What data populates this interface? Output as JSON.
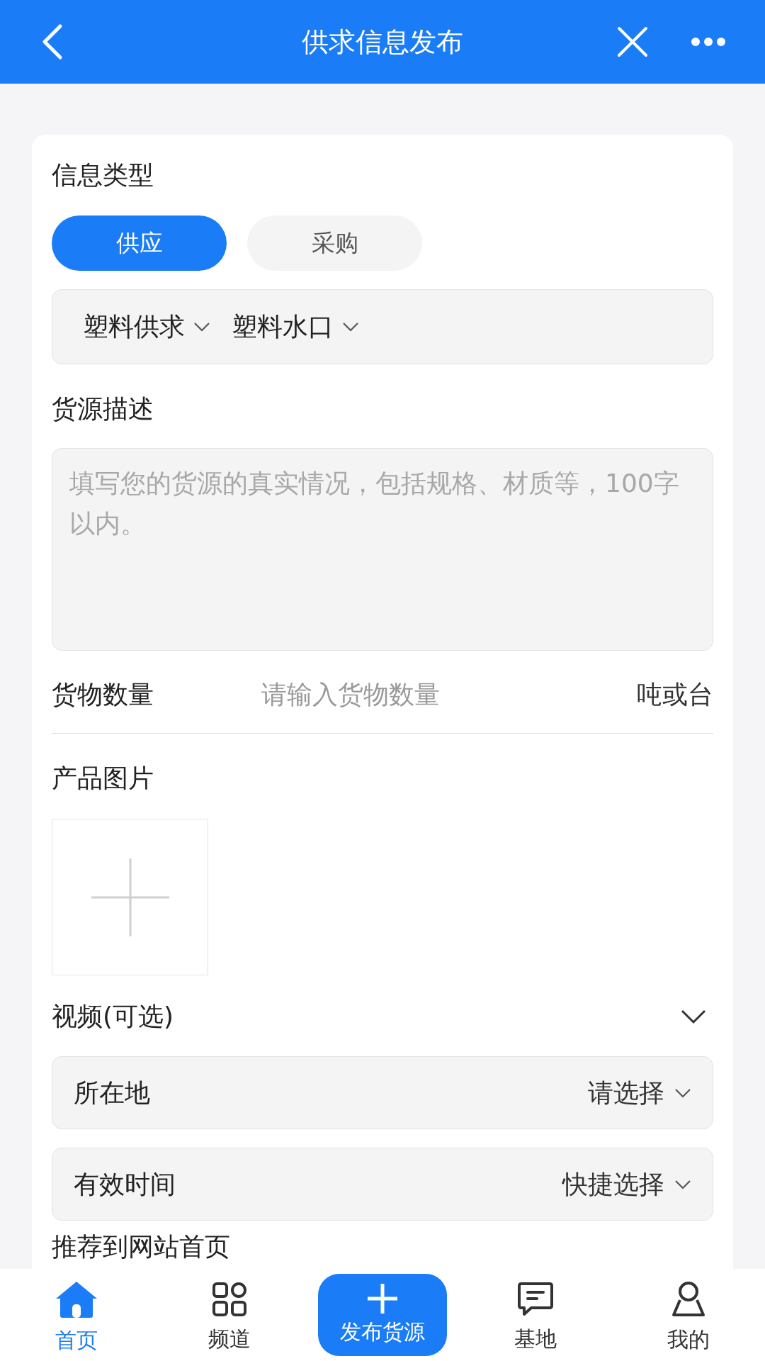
{
  "header": {
    "title": "供求信息发布"
  },
  "form": {
    "info_type": {
      "label": "信息类型",
      "options": [
        {
          "label": "供应",
          "selected": true
        },
        {
          "label": "采购",
          "selected": false
        }
      ]
    },
    "category": [
      {
        "label": "塑料供求"
      },
      {
        "label": "塑料水口"
      }
    ],
    "description": {
      "label": "货源描述",
      "placeholder": "填写您的货源的真实情况，包括规格、材质等，100字以内。"
    },
    "quantity": {
      "label": "货物数量",
      "placeholder": "请输入货物数量",
      "unit": "吨或台"
    },
    "images": {
      "label": "产品图片"
    },
    "video": {
      "label": "视频(可选)",
      "expanded": false
    },
    "selects": [
      {
        "label": "所在地",
        "value": "请选择"
      },
      {
        "label": "有效时间",
        "value": "快捷选择"
      }
    ],
    "recommend": {
      "label": "推荐到网站首页"
    }
  },
  "nav": [
    {
      "kind": "home",
      "label": "首页",
      "selected": true
    },
    {
      "kind": "grid",
      "label": "频道",
      "selected": false
    },
    {
      "kind": "publish",
      "label": "发布货源"
    },
    {
      "kind": "message",
      "label": "基地",
      "selected": false
    },
    {
      "kind": "person",
      "label": "我的",
      "selected": false
    }
  ]
}
